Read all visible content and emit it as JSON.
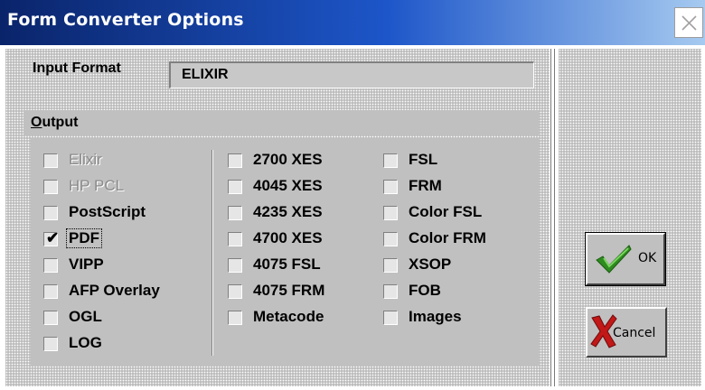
{
  "window": {
    "title": "Form Converter Options",
    "close_icon": "close-icon"
  },
  "input_format": {
    "label": "Input Format",
    "value": "ELIXIR"
  },
  "output": {
    "title_hotkey": "O",
    "title_rest": "utput",
    "columns": [
      [
        {
          "label": "Elixir",
          "checked": false,
          "enabled": false
        },
        {
          "label": "HP PCL",
          "checked": false,
          "enabled": false
        },
        {
          "label": "PostScript",
          "checked": false,
          "enabled": true
        },
        {
          "label": "PDF",
          "checked": true,
          "enabled": true
        },
        {
          "label": "VIPP",
          "checked": false,
          "enabled": true
        },
        {
          "label": "AFP Overlay",
          "checked": false,
          "enabled": true
        },
        {
          "label": "OGL",
          "checked": false,
          "enabled": true
        },
        {
          "label": "LOG",
          "checked": false,
          "enabled": true
        }
      ],
      [
        {
          "label": "2700 XES",
          "checked": false,
          "enabled": true
        },
        {
          "label": "4045 XES",
          "checked": false,
          "enabled": true
        },
        {
          "label": "4235 XES",
          "checked": false,
          "enabled": true
        },
        {
          "label": "4700 XES",
          "checked": false,
          "enabled": true
        },
        {
          "label": "4075 FSL",
          "checked": false,
          "enabled": true
        },
        {
          "label": "4075 FRM",
          "checked": false,
          "enabled": true
        },
        {
          "label": "Metacode",
          "checked": false,
          "enabled": true
        }
      ],
      [
        {
          "label": "FSL",
          "checked": false,
          "enabled": true
        },
        {
          "label": "FRM",
          "checked": false,
          "enabled": true
        },
        {
          "label": "Color FSL",
          "checked": false,
          "enabled": true
        },
        {
          "label": "Color FRM",
          "checked": false,
          "enabled": true
        },
        {
          "label": "XSOP",
          "checked": false,
          "enabled": true
        },
        {
          "label": "FOB",
          "checked": false,
          "enabled": true
        },
        {
          "label": "Images",
          "checked": false,
          "enabled": true
        }
      ]
    ]
  },
  "buttons": {
    "ok_label": "OK",
    "ok_icon": "checkmark-icon",
    "cancel_hotkey": "X",
    "cancel_rest": "Cancel",
    "cancel_icon": "red-x-icon"
  },
  "colors": {
    "title_bar_start": "#0a246a",
    "title_bar_end": "#a6caf0",
    "ok_check": "#2e8b1f",
    "cancel_x": "#c21818"
  }
}
